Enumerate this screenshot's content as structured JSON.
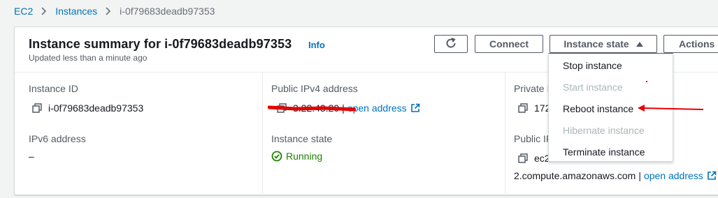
{
  "breadcrumb": {
    "ec2": "EC2",
    "instances": "Instances",
    "current": "i-0f79683deadb97353"
  },
  "header": {
    "title": "Instance summary for i-0f79683deadb97353",
    "info": "Info",
    "updated": "Updated less than a minute ago",
    "connect": "Connect",
    "instance_state": "Instance state",
    "actions": "Actions"
  },
  "details": {
    "instance_id_label": "Instance ID",
    "instance_id": "i-0f79683deadb97353",
    "ipv6_label": "IPv6 address",
    "ipv6_value": "–",
    "public_ipv4_label": "Public IPv4 address",
    "public_ipv4_value": "3.22.43.20",
    "open_address": "open address",
    "instance_state_label": "Instance state",
    "instance_state_value": "Running",
    "private_label": "Private I",
    "private_value": "172",
    "public_dns_label": "Public IF",
    "public_dns_value": "ec2",
    "public_dns_tail": "2.compute.amazonaws.com",
    "open_address_2": "open address"
  },
  "menu": [
    {
      "label": "Stop instance",
      "enabled": true
    },
    {
      "label": "Start instance",
      "enabled": false
    },
    {
      "label": "Reboot instance",
      "enabled": true
    },
    {
      "label": "Hibernate instance",
      "enabled": false
    },
    {
      "label": "Terminate instance",
      "enabled": true
    }
  ],
  "colors": {
    "link": "#0073bb",
    "running": "#1d8102",
    "annotation": "#e60000"
  }
}
